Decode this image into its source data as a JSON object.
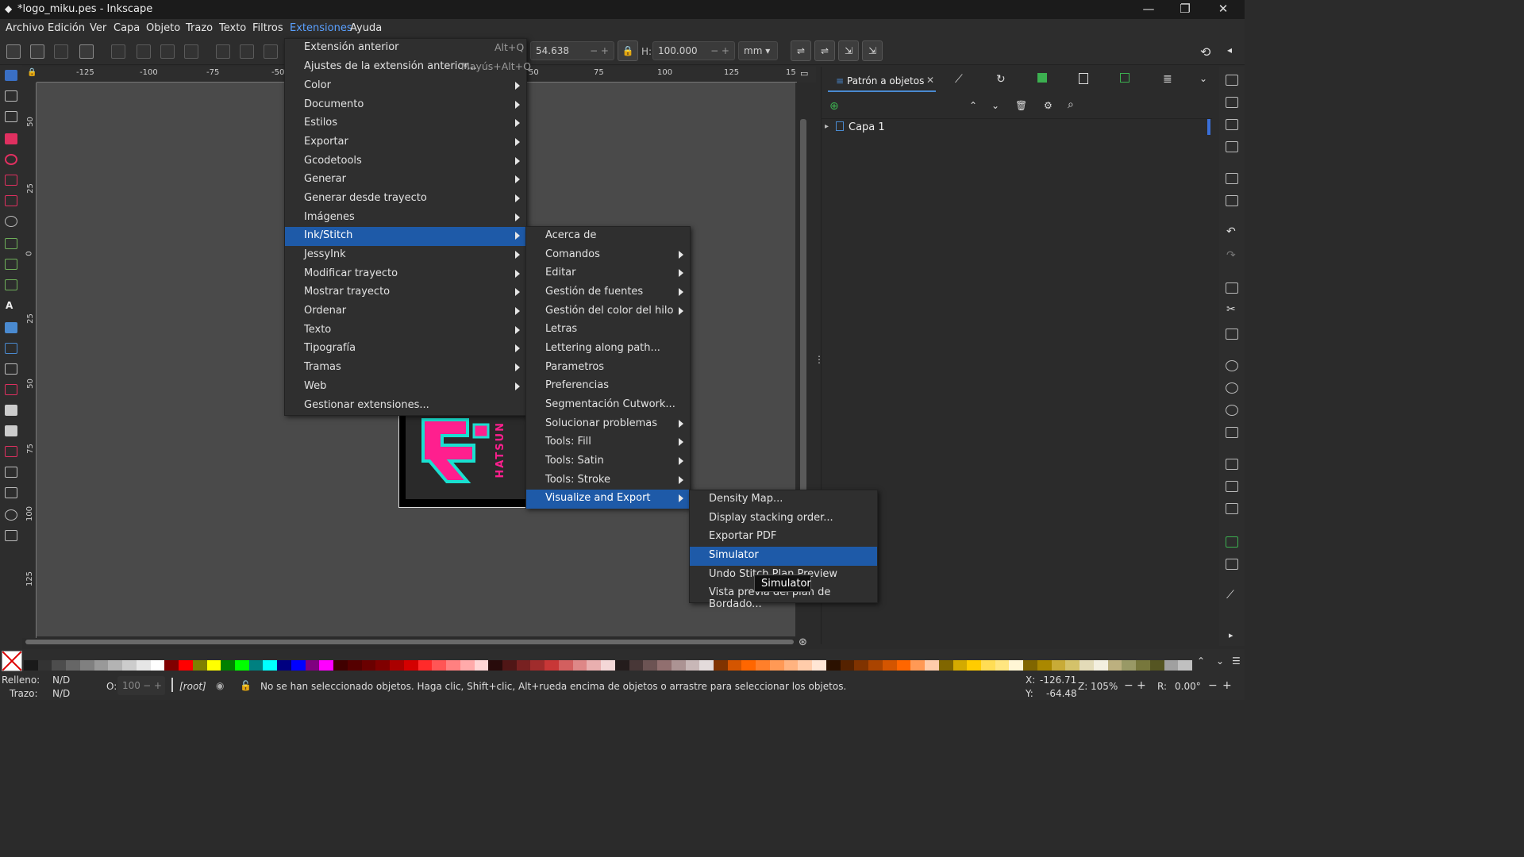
{
  "window": {
    "title": "*logo_miku.pes - Inkscape"
  },
  "menubar": [
    "Archivo",
    "Edición",
    "Ver",
    "Capa",
    "Objeto",
    "Trazo",
    "Texto",
    "Filtros",
    "Extensiones",
    "Ayuda"
  ],
  "toolbar": {
    "w_value": "54.638",
    "h_label": "H:",
    "h_value": "100.000",
    "unit": "mm"
  },
  "ruler": {
    "h_ticks": [
      "-125",
      "-100",
      "-75",
      "-50",
      "50",
      "75",
      "100",
      "125",
      "15"
    ],
    "v_ticks": [
      "50",
      "25",
      "0",
      "25",
      "50",
      "75",
      "100",
      "125"
    ]
  },
  "logo_text": "HATSUN",
  "ext_menu": {
    "items": [
      {
        "label": "Extensión anterior",
        "shortcut": "Alt+Q"
      },
      {
        "label": "Ajustes de la extensión anterior...",
        "shortcut": "Mayús+Alt+Q"
      },
      {
        "label": "Color"
      },
      {
        "label": "Documento"
      },
      {
        "label": "Estilos"
      },
      {
        "label": "Exportar"
      },
      {
        "label": "Gcodetools"
      },
      {
        "label": "Generar"
      },
      {
        "label": "Generar desde trayecto"
      },
      {
        "label": "Imágenes"
      },
      {
        "label": "Ink/Stitch"
      },
      {
        "label": "JessyInk"
      },
      {
        "label": "Modificar trayecto"
      },
      {
        "label": "Mostrar trayecto"
      },
      {
        "label": "Ordenar"
      },
      {
        "label": "Texto"
      },
      {
        "label": "Tipografía"
      },
      {
        "label": "Tramas"
      },
      {
        "label": "Web"
      },
      {
        "label": "Gestionar extensiones..."
      }
    ]
  },
  "inkstitch_menu": {
    "items": [
      "Acerca de",
      "Comandos",
      "Editar",
      "Gestión de fuentes",
      "Gestión del color del hilo",
      "Letras",
      "Lettering along path...",
      "Parametros",
      "Preferencias",
      "Segmentación Cutwork...",
      "Solucionar problemas",
      "Tools: Fill",
      "Tools: Satin",
      "Tools: Stroke",
      "Visualize and Export"
    ]
  },
  "visualize_menu": {
    "items": [
      "Density Map...",
      "Display stacking order...",
      "Exportar PDF",
      "Simulator",
      "Undo Stitch Plan Preview",
      "Vista previa del plan de Bordado..."
    ]
  },
  "tooltip": "Simulator",
  "dock": {
    "tab_label": "Patrón a objetos",
    "layer_name": "Capa 1"
  },
  "status": {
    "fill_label": "Relleno:",
    "fill_value": "N/D",
    "stroke_label": "Trazo:",
    "stroke_value": "N/D",
    "opacity_label": "O:",
    "opacity_value": "100",
    "layer": "[root]",
    "message": "No se han seleccionado objetos. Haga clic, Shift+clic, Alt+rueda encima de objetos o arrastre para seleccionar los objetos.",
    "x_label": "X:",
    "x_value": "-126.71",
    "y_label": "Y:",
    "y_value": "-64.48",
    "zoom_label": "Z:",
    "zoom_value": "105%",
    "rot_label": "R:",
    "rot_value": "0.00°"
  },
  "palette_colors": [
    "#1a1a1a",
    "#333333",
    "#4d4d4d",
    "#666666",
    "#808080",
    "#999999",
    "#b3b3b3",
    "#cccccc",
    "#e6e6e6",
    "#ffffff",
    "#800000",
    "#ff0000",
    "#808000",
    "#ffff00",
    "#008000",
    "#00ff00",
    "#008080",
    "#00ffff",
    "#000080",
    "#0000ff",
    "#800080",
    "#ff00ff",
    "#400000",
    "#550000",
    "#6a0000",
    "#800000",
    "#aa0000",
    "#d40000",
    "#ff2a2a",
    "#ff5555",
    "#ff8080",
    "#ffaaaa",
    "#ffd5d5",
    "#280b0b",
    "#501616",
    "#782121",
    "#a02c2c",
    "#c83737",
    "#d35f5f",
    "#de8787",
    "#e9afaf",
    "#f4d7d7",
    "#241c1c",
    "#483737",
    "#6c5353",
    "#916f6f",
    "#ac9393",
    "#c8b7b7",
    "#e3dbdb",
    "#803300",
    "#d45500",
    "#ff6600",
    "#ff7f2a",
    "#ff9955",
    "#ffb380",
    "#ffccaa",
    "#ffe6d5",
    "#2b1100",
    "#552200",
    "#803300",
    "#aa4400",
    "#d45500",
    "#ff6600",
    "#ff9955",
    "#ffccaa",
    "#806600",
    "#d4aa00",
    "#ffcc00",
    "#ffdd55",
    "#ffe680",
    "#fff6d5",
    "#806600",
    "#aa8800",
    "#c8ab37",
    "#d4c26a",
    "#e3dbb8",
    "#f3efe0",
    "#bcb07f",
    "#999966",
    "#77773c",
    "#555522",
    "#a0a0a0",
    "#c0c0c0"
  ]
}
